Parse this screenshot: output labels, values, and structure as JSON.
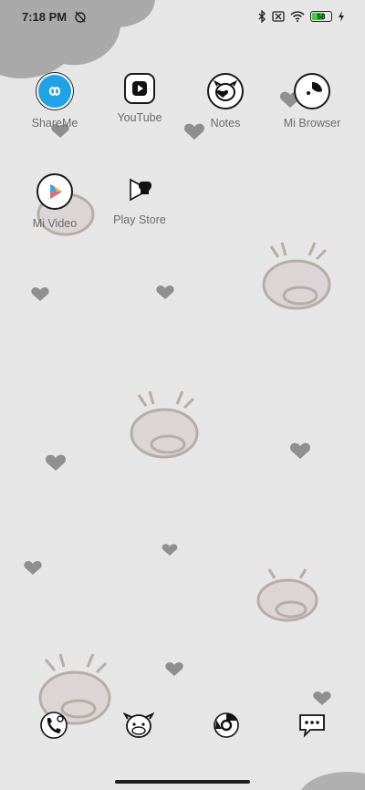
{
  "status_bar": {
    "time": "7:18 PM",
    "battery_level": "58",
    "icons": [
      "alarm-off-icon",
      "bluetooth-icon",
      "sim-off-icon",
      "wifi-icon",
      "battery-icon",
      "charging-icon"
    ]
  },
  "apps": [
    {
      "label": "ShareMe",
      "icon": "shareme-icon"
    },
    {
      "label": "YouTube",
      "icon": "youtube-icon"
    },
    {
      "label": "Notes",
      "icon": "notes-icon"
    },
    {
      "label": "Mi Browser",
      "icon": "mi-browser-icon"
    },
    {
      "label": "Mi Video",
      "icon": "mi-video-icon"
    },
    {
      "label": "Play Store",
      "icon": "play-store-icon"
    }
  ],
  "dock": [
    {
      "icon": "phone-icon"
    },
    {
      "icon": "messaging-cow-icon"
    },
    {
      "icon": "chrome-icon"
    },
    {
      "icon": "chat-icon"
    }
  ],
  "colors": {
    "background": "#e6e6e6",
    "label": "#6b6b6b",
    "shareme_blue": "#1fa3e6",
    "decor": "#8c8c8c"
  }
}
